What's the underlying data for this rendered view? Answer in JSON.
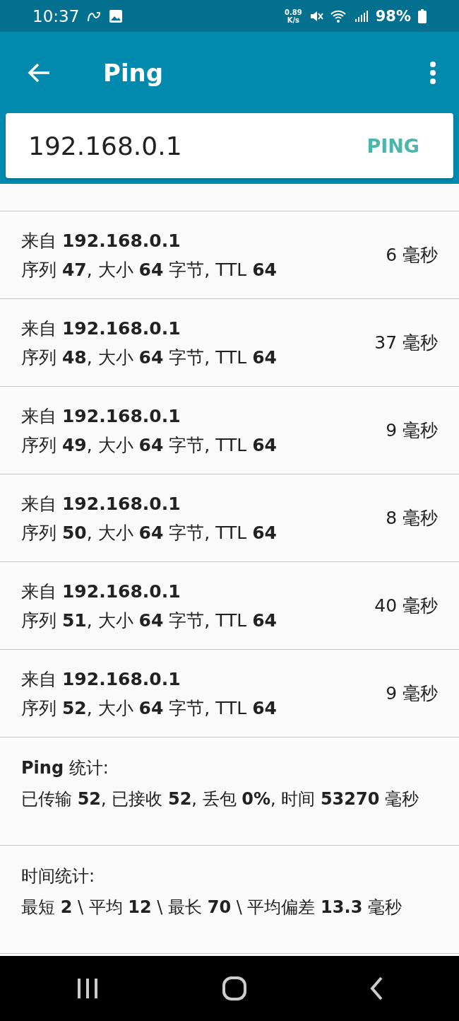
{
  "status_bar": {
    "time": "10:37",
    "net_speed_value": "0.89",
    "net_speed_unit": "K/s",
    "battery": "98%"
  },
  "app_bar": {
    "title": "Ping"
  },
  "search": {
    "value": "192.168.0.1",
    "button": "PING"
  },
  "results": [
    {
      "source": "来自 **192.168.0.1**",
      "detail": "序列 **47**, 大小 **64** 字节, TTL **64**",
      "time": "6 毫秒"
    },
    {
      "source": "来自 **192.168.0.1**",
      "detail": "序列 **48**, 大小 **64** 字节, TTL **64**",
      "time": "37 毫秒"
    },
    {
      "source": "来自 **192.168.0.1**",
      "detail": "序列 **49**, 大小 **64** 字节, TTL **64**",
      "time": "9 毫秒"
    },
    {
      "source": "来自 **192.168.0.1**",
      "detail": "序列 **50**, 大小 **64** 字节, TTL **64**",
      "time": "8 毫秒"
    },
    {
      "source": "来自 **192.168.0.1**",
      "detail": "序列 **51**, 大小 **64** 字节, TTL **64**",
      "time": "40 毫秒"
    },
    {
      "source": "来自 **192.168.0.1**",
      "detail": "序列 **52**, 大小 **64** 字节, TTL **64**",
      "time": "9 毫秒"
    }
  ],
  "statistics": [
    {
      "title": "**Ping** 统计:",
      "body": "已传输 **52**, 已接收 **52**, 丢包 **0%**, 时间 **53270** 毫秒"
    },
    {
      "title": "时间统计:",
      "body": "最短 **2** \\ 平均 **12** \\ 最长 **70** \\ 平均偏差 **13.3** 毫秒"
    }
  ]
}
